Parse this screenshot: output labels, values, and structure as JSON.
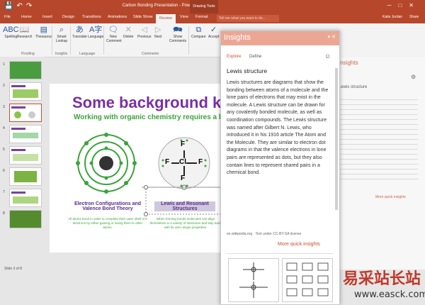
{
  "window": {
    "doc_title": "Carbon Bonding Presentation - PowerPoint",
    "context_group": "Drawing Tools",
    "user": "Katie Jordan",
    "share": "Share",
    "tell_me": "Tell me what you want to do..."
  },
  "tabs": [
    "File",
    "Home",
    "Insert",
    "Design",
    "Transitions",
    "Animations",
    "Slide Show",
    "Review",
    "View",
    "Format"
  ],
  "active_tab": "Review",
  "ribbon": {
    "buttons": [
      "Spelling",
      "Research",
      "Thesaurus",
      "Smart Lookup",
      "Translate",
      "Language",
      "New Comment",
      "Delete",
      "Previous",
      "Next",
      "Show Comments",
      "Compare",
      "Accept"
    ],
    "groups": [
      "Proofing",
      "Insights",
      "Language",
      "Comments"
    ]
  },
  "thumbnails": [
    "1",
    "2",
    "3",
    "4",
    "5",
    "6",
    "7",
    "8"
  ],
  "slide": {
    "title": "Some background kn",
    "subtitle": "Working with organic chemistry requires a lot of bac",
    "left_heading": "Electron Configurations and Valence Bond Theory",
    "left_body": "All atoms bond in order to complete their outer shell of 8 electrons by either gaining or losing them to other atoms.",
    "right_heading": "Lewis and Resonant Structures",
    "right_body": "When forming bonds molecules can align themselves in a variety of structures and stay each with its own unique properties.",
    "molecule_labels": [
      "F",
      "F",
      "Cl",
      "F",
      "F"
    ]
  },
  "status": {
    "slide_of": "Slide 3 of 8"
  },
  "insights": {
    "title": "Insights",
    "tabs": [
      "Explore",
      "Define"
    ],
    "heading": "Lewis structure",
    "body": "Lewis structures are diagrams that show the bonding between atoms of a molecule and the lone pairs of electrons that may exist in the molecule. A Lewis structure can be drawn for any covalently bonded molecule, as well as coordination compounds. The Lewis structure was named after Gilbert N. Lewis, who introduced it in his 1916 article The Atom and the Molecule. They are similar to electron dot diagrams in that the valence electrons in lone pairs are represented as dots, but they also contain lines to represent shared pairs in a chemical bond.",
    "source": "en.wikipedia.org · Text under CC-BY-SA license",
    "more": "More quick insights"
  },
  "insights_bg": {
    "title": "Insights",
    "heading": "Lewis structure",
    "more": "More quick insights"
  },
  "watermark": {
    "cn": "易采站长站",
    "url": "www.easck.com"
  },
  "colors": {
    "accent": "#b7472a",
    "purple": "#7b2fa3",
    "green": "#3aa43a"
  }
}
